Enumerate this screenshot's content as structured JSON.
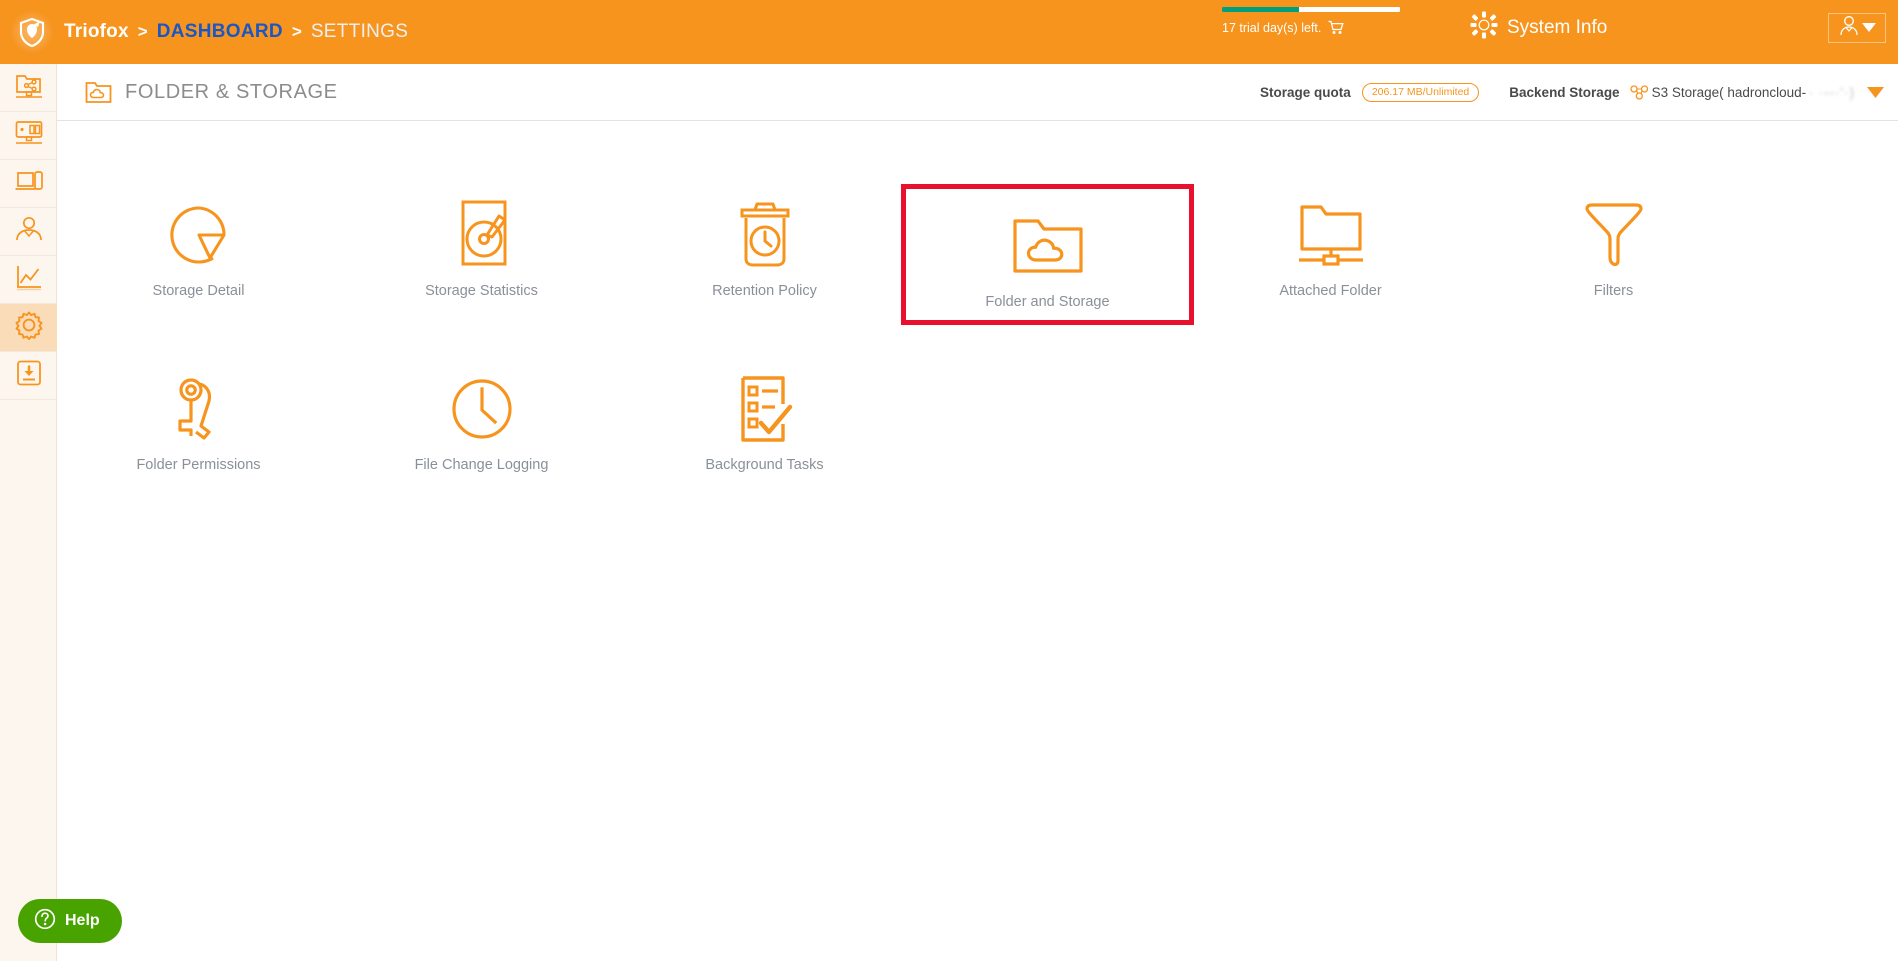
{
  "topbar": {
    "brand": "Triofox",
    "separator": ">",
    "breadcrumb_link": "DASHBOARD",
    "breadcrumb_current": "SETTINGS",
    "trial_text": "17 trial day(s) left.",
    "trial_progress_percent": 43,
    "trial_bar_fill_color": "#00a07e",
    "system_info_label": "System Info",
    "background_color": "#f7941e",
    "breadcrumb_link_color": "#1a57c4",
    "cart_icon": "shopping-cart-icon",
    "gear_icon": "gear-icon",
    "user_icon": "user-avatar-icon",
    "caret_icon": "chevron-down-icon"
  },
  "sidebar": {
    "items": [
      {
        "name": "shared-folder",
        "icon": "share-folder-network-icon",
        "active": false
      },
      {
        "name": "devices",
        "icon": "monitor-devices-icon",
        "active": false
      },
      {
        "name": "clients",
        "icon": "laptop-mobile-icon",
        "active": false
      },
      {
        "name": "users",
        "icon": "user-profile-icon",
        "active": false
      },
      {
        "name": "reports",
        "icon": "line-chart-icon",
        "active": false
      },
      {
        "name": "settings",
        "icon": "gear-icon",
        "active": true
      },
      {
        "name": "downloads",
        "icon": "download-box-icon",
        "active": false
      }
    ],
    "active_background": "#fbdcb9",
    "background": "#fdf6ef"
  },
  "page_header": {
    "icon": "folder-cloud-icon",
    "title": "FOLDER & STORAGE",
    "storage_quota_label": "Storage quota",
    "storage_quota_value": "206.17 MB/Unlimited",
    "backend_storage_label": "Backend Storage",
    "backend_storage_icon": "cloud-nodes-icon",
    "backend_storage_value": "S3 Storage( hadroncloud-",
    "backend_storage_value_blurred": "·   ·--·'·)",
    "dropdown_icon": "caret-down-icon"
  },
  "tiles": [
    {
      "label": "Storage Detail",
      "icon": "pie-chart-icon",
      "highlighted": false
    },
    {
      "label": "Storage Statistics",
      "icon": "disk-gauge-icon",
      "highlighted": false
    },
    {
      "label": "Retention Policy",
      "icon": "trash-clock-icon",
      "highlighted": false
    },
    {
      "label": "Folder and Storage",
      "icon": "folder-cloud-icon",
      "highlighted": true
    },
    {
      "label": "Attached Folder",
      "icon": "folder-network-icon",
      "highlighted": false
    },
    {
      "label": "Filters",
      "icon": "funnel-icon",
      "highlighted": false
    },
    {
      "label": "Folder Permissions",
      "icon": "keys-icon",
      "highlighted": false
    },
    {
      "label": "File Change Logging",
      "icon": "clock-icon",
      "highlighted": false
    },
    {
      "label": "Background Tasks",
      "icon": "checklist-icon",
      "highlighted": false
    }
  ],
  "highlight": {
    "color": "#e8112d",
    "target_label": "Folder and Storage"
  },
  "help": {
    "label": "Help",
    "icon": "question-circle-icon",
    "background_color": "#48a200"
  },
  "theme": {
    "accent_orange": "#f7941e",
    "icon_orange": "#f58220",
    "label_gray": "#8a9099",
    "title_gray": "#8c8c8c"
  }
}
